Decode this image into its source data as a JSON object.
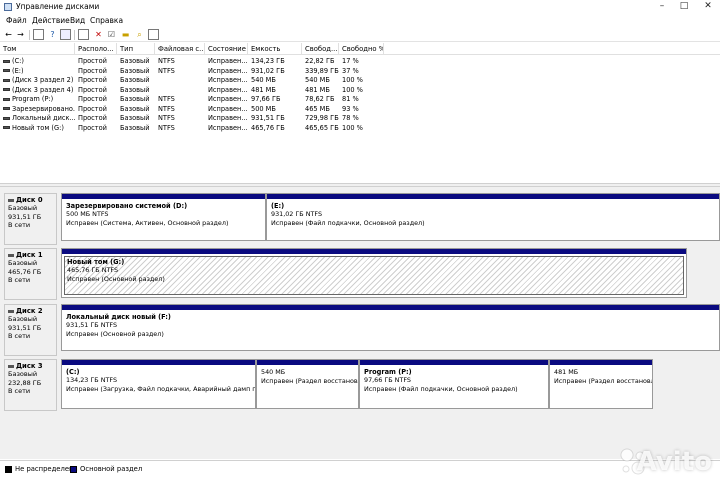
{
  "window": {
    "title": "Управление дисками"
  },
  "menu": [
    "Файл",
    "Действие",
    "Вид",
    "Справка"
  ],
  "columns": [
    "Том",
    "Располо...",
    "Тип",
    "Файловая с...",
    "Состояние",
    "Емкость",
    "Свобод...",
    "Свободно %"
  ],
  "volumes": [
    [
      "(C:)",
      "Простой",
      "Базовый",
      "NTFS",
      "Исправен...",
      "134,23 ГБ",
      "22,82 ГБ",
      "17 %"
    ],
    [
      "(E:)",
      "Простой",
      "Базовый",
      "NTFS",
      "Исправен...",
      "931,02 ГБ",
      "339,89 ГБ",
      "37 %"
    ],
    [
      "(Диск 3 раздел 2)",
      "Простой",
      "Базовый",
      "",
      "Исправен...",
      "540 МБ",
      "540 МБ",
      "100 %"
    ],
    [
      "(Диск 3 раздел 4)",
      "Простой",
      "Базовый",
      "",
      "Исправен...",
      "481 МБ",
      "481 МБ",
      "100 %"
    ],
    [
      "Program (P:)",
      "Простой",
      "Базовый",
      "NTFS",
      "Исправен...",
      "97,66 ГБ",
      "78,62 ГБ",
      "81 %"
    ],
    [
      "Зарезервировано...",
      "Простой",
      "Базовый",
      "NTFS",
      "Исправен...",
      "500 МБ",
      "465 МБ",
      "93 %"
    ],
    [
      "Локальный диск...",
      "Простой",
      "Базовый",
      "NTFS",
      "Исправен...",
      "931,51 ГБ",
      "729,98 ГБ",
      "78 %"
    ],
    [
      "Новый том (G:)",
      "Простой",
      "Базовый",
      "NTFS",
      "Исправен...",
      "465,76 ГБ",
      "465,65 ГБ",
      "100 %"
    ]
  ],
  "disks": [
    {
      "name": "Диск 0",
      "type": "Базовый",
      "size": "931,51 ГБ",
      "status": "В сети",
      "partitions": [
        {
          "name": "Зарезервировано системой (D:)",
          "size": "500 МБ NTFS",
          "status": "Исправен (Система, Активен, Основной раздел)"
        },
        {
          "name": "(E:)",
          "size": "931,02 ГБ NTFS",
          "status": "Исправен (Файл подкачки, Основной раздел)"
        }
      ]
    },
    {
      "name": "Диск 1",
      "type": "Базовый",
      "size": "465,76 ГБ",
      "status": "В сети",
      "partitions": [
        {
          "name": "Новый том (G:)",
          "size": "465,76 ГБ NTFS",
          "status": "Исправен (Основной раздел)"
        }
      ]
    },
    {
      "name": "Диск 2",
      "type": "Базовый",
      "size": "931,51 ГБ",
      "status": "В сети",
      "partitions": [
        {
          "name": "Локальный диск новый (F:)",
          "size": "931,51 ГБ NTFS",
          "status": "Исправен (Основной раздел)"
        }
      ]
    },
    {
      "name": "Диск 3",
      "type": "Базовый",
      "size": "232,88 ГБ",
      "status": "В сети",
      "partitions": [
        {
          "name": "(C:)",
          "size": "134,23 ГБ NTFS",
          "status": "Исправен (Загрузка, Файл подкачки, Аварийный дамп памя"
        },
        {
          "name": "",
          "size": "540 МБ",
          "status": "Исправен (Раздел восстановле"
        },
        {
          "name": "Program (P:)",
          "size": "97,66 ГБ NTFS",
          "status": "Исправен (Файл подкачки, Основной раздел)"
        },
        {
          "name": "",
          "size": "481 МБ",
          "status": "Исправен (Раздел восстановле"
        }
      ]
    }
  ],
  "legend": {
    "unallocated": "Не распределена",
    "primary": "Основной раздел"
  },
  "colors": {
    "primary_bar": "#0a0a80",
    "unallocated": "#000000"
  },
  "watermark": "Avito"
}
